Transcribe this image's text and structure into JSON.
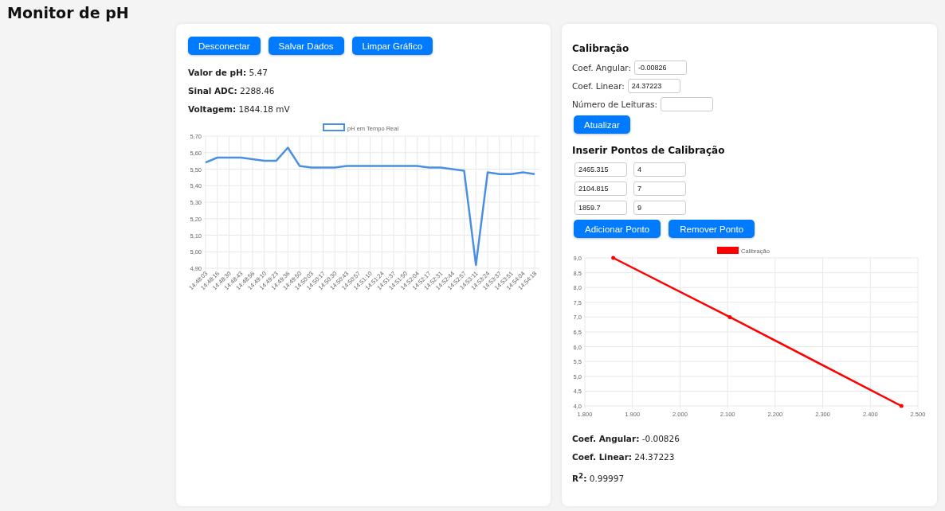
{
  "title": "Monitor de pH",
  "monitor": {
    "buttons": [
      "Desconectar",
      "Salvar Dados",
      "Limpar Gráfico"
    ],
    "readings": [
      "**Valor de pH:** 5.47",
      "**Sinal ADC:** 2288.46",
      "**Voltagem:** 1844.18 mV"
    ],
    "chart_data": {
      "type": "line",
      "grid": true,
      "categories": [
        "14:48:03",
        "14:48:16",
        "14:48:30",
        "14:48:43",
        "14:48:56",
        "14:49:10",
        "14:49:23",
        "14:49:36",
        "14:49:50",
        "14:50:03",
        "14:50:17",
        "14:50:30",
        "14:50:43",
        "14:50:57",
        "14:51:10",
        "14:51:24",
        "14:51:37",
        "14:51:50",
        "14:52:04",
        "14:52:17",
        "14:52:31",
        "14:52:44",
        "14:52:57",
        "14:53:11",
        "14:53:24",
        "14:53:37",
        "14:53:51",
        "14:54:04",
        "14:54:18"
      ],
      "series": [
        {
          "name": "pH em Tempo Real",
          "color": "#4a90e2",
          "values": [
            5.54,
            5.57,
            5.57,
            5.57,
            5.56,
            5.55,
            5.55,
            5.63,
            5.52,
            5.51,
            5.51,
            5.51,
            5.52,
            5.52,
            5.52,
            5.52,
            5.52,
            5.52,
            5.52,
            5.51,
            5.51,
            5.5,
            5.49,
            4.92,
            5.48,
            5.47,
            5.47,
            5.48,
            5.47
          ]
        }
      ],
      "ylim": [
        4.9,
        5.7
      ],
      "yticks": [
        {
          "value": 4.9,
          "label": "4,90"
        },
        {
          "value": 5.0,
          "label": "5,00"
        },
        {
          "value": 5.1,
          "label": "5,10"
        },
        {
          "value": 5.2,
          "label": "5,20"
        },
        {
          "value": 5.3,
          "label": "5,30"
        },
        {
          "value": 5.4,
          "label": "5,40"
        },
        {
          "value": 5.5,
          "label": "5,50"
        },
        {
          "value": 5.6,
          "label": "5,60"
        },
        {
          "value": 5.7,
          "label": "5,70"
        }
      ]
    }
  },
  "calibration": {
    "title": "Calibração",
    "fields": [
      {
        "label": "Coef. Angular:",
        "value": "-0.00826"
      },
      {
        "label": "Coef. Linear:",
        "value": "24.37223"
      },
      {
        "label": "Número de Leituras:"
      }
    ],
    "update_button": "Atualizar",
    "points_title": "Inserir Pontos de Calibração",
    "points": [
      {
        "adc": "2465.315",
        "ph": "4"
      },
      {
        "adc": "2104.815",
        "ph": "7"
      },
      {
        "adc": "1859.7",
        "ph": "9"
      }
    ],
    "buttons": [
      "Adicionar Ponto",
      "Remover Ponto"
    ],
    "chart_data": {
      "type": "line",
      "grid": true,
      "x": [
        1859.7,
        2104.815,
        2465.315
      ],
      "series": [
        {
          "name": "Calibração",
          "color": "#ff0000",
          "values": [
            9,
            7,
            4
          ]
        }
      ],
      "xlim": [
        1800,
        2500
      ],
      "ylim": [
        4,
        9
      ],
      "xticks": [
        {
          "value": 1800,
          "label": "1.800"
        },
        {
          "value": 1900,
          "label": "1.900"
        },
        {
          "value": 2000,
          "label": "2.000"
        },
        {
          "value": 2100,
          "label": "2.100"
        },
        {
          "value": 2200,
          "label": "2.200"
        },
        {
          "value": 2300,
          "label": "2.300"
        },
        {
          "value": 2400,
          "label": "2.400"
        },
        {
          "value": 2500,
          "label": "2.500"
        }
      ],
      "yticks": [
        {
          "value": 4,
          "label": "4,0"
        },
        {
          "value": 4.5,
          "label": "4,5"
        },
        {
          "value": 5,
          "label": "5,0"
        },
        {
          "value": 5.5,
          "label": "5,5"
        },
        {
          "value": 6,
          "label": "6,0"
        },
        {
          "value": 6.5,
          "label": "6,5"
        },
        {
          "value": 7,
          "label": "7,0"
        },
        {
          "value": 7.5,
          "label": "7,5"
        },
        {
          "value": 8,
          "label": "8,0"
        },
        {
          "value": 8.5,
          "label": "8,5"
        },
        {
          "value": 9,
          "label": "9,0"
        }
      ]
    },
    "results": [
      "**Coef. Angular:** -0.00826",
      "**Coef. Linear:** 24.37223",
      "**R$^{2}$:** 0.99997"
    ]
  }
}
